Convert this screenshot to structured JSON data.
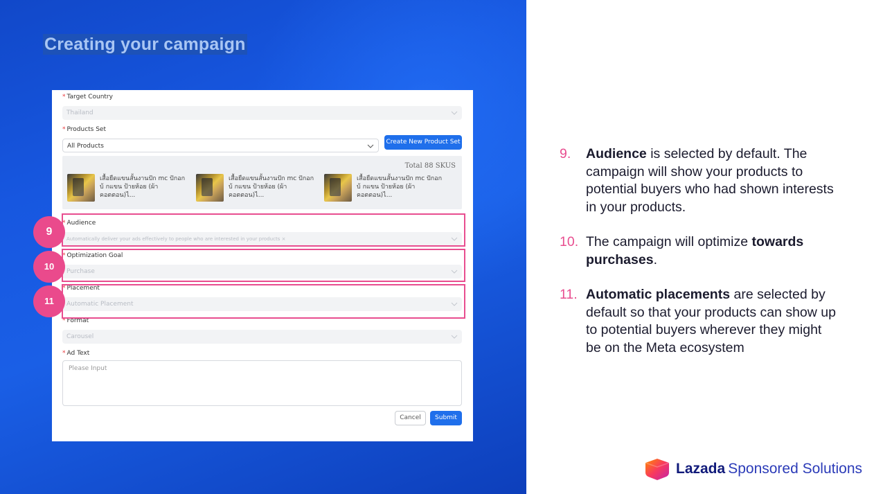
{
  "slide": {
    "title": "Creating your campaign"
  },
  "form": {
    "target_country": {
      "label": "Target Country",
      "value": "Thailand"
    },
    "products_set": {
      "label": "Products Set",
      "value": "All Products",
      "create_button": "Create New Product Set"
    },
    "product_panel": {
      "total": "Total 88 SKUS",
      "products": [
        {
          "name": "เสื้อยืดแขนสั้นงานปัก mc ปักอก บ้ กแขน ป้ายห้อย (ผ้าคอตตอน)ไ..."
        },
        {
          "name": "เสื้อยืดแขนสั้นงานปัก mc ปักอก บ้ กแขน ป้ายห้อย (ผ้าคอตตอน)ไ..."
        },
        {
          "name": "เสื้อยืดแขนสั้นงานปัก mc ปักอก บ้ กแขน ป้ายห้อย (ผ้าคอตตอน)ไ..."
        }
      ]
    },
    "audience": {
      "label": "Audience",
      "value": "Automatically deliver your ads effectively to people who are interested in your products",
      "tag_close": "×"
    },
    "optimization_goal": {
      "label": "Optimization Goal",
      "value": "Purchase"
    },
    "placement": {
      "label": "Placement",
      "value": "Automatic Placement"
    },
    "format": {
      "label": "Format",
      "value": "Carousel"
    },
    "ad_text": {
      "label": "Ad Text",
      "placeholder": "Please Input"
    },
    "required_mark": "*",
    "cancel_button": "Cancel",
    "submit_button": "Submit"
  },
  "callouts": [
    "9",
    "10",
    "11"
  ],
  "steps": [
    {
      "number": "9.",
      "bold": "Audience",
      "text": " is selected by default. The campaign will show your products to potential buyers who had shown interests in your products."
    },
    {
      "number": "10.",
      "pre": "The campaign will optimize ",
      "bold": "towards purchases",
      "post": "."
    },
    {
      "number": "11.",
      "bold": "Automatic placements",
      "text": " are selected by default so that your products can show up to potential buyers wherever they might be on the Meta ecosystem"
    }
  ],
  "brand": {
    "word1": "Lazada",
    "word2": "Sponsored Solutions",
    "colors": {
      "accent_pink": "#e84d8f",
      "primary_blue": "#1f6feb",
      "brand_navy": "#101a7a"
    }
  }
}
